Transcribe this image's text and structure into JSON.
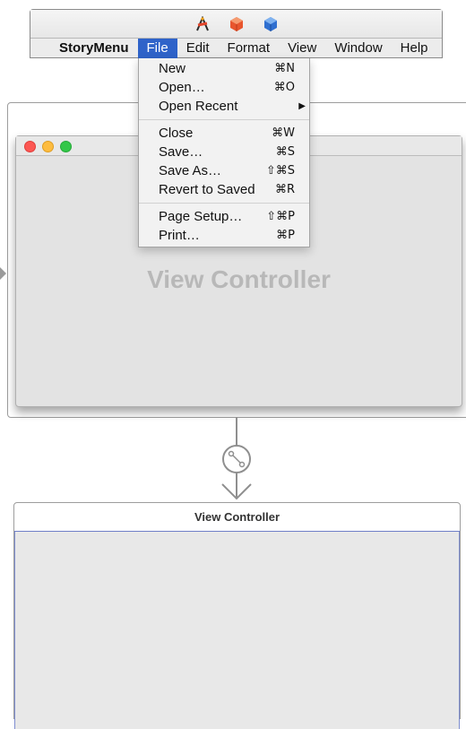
{
  "menubar": {
    "app_name": "StoryMenu",
    "items": [
      "File",
      "Edit",
      "Format",
      "View",
      "Window",
      "Help"
    ],
    "selected": "File",
    "selected_color": "#2f63c9"
  },
  "scene_dock_icons": [
    "app-icon",
    "first-responder-icon",
    "object-cube-icon"
  ],
  "file_menu": {
    "groups": [
      [
        {
          "label": "New",
          "shortcut": "⌘N"
        },
        {
          "label": "Open…",
          "shortcut": "⌘O"
        },
        {
          "label": "Open Recent",
          "submenu": true
        }
      ],
      [
        {
          "label": "Close",
          "shortcut": "⌘W"
        },
        {
          "label": "Save…",
          "shortcut": "⌘S"
        },
        {
          "label": "Save As…",
          "shortcut": "⇧⌘S"
        },
        {
          "label": "Revert to Saved",
          "shortcut": "⌘R"
        }
      ],
      [
        {
          "label": "Page Setup…",
          "shortcut": "⇧⌘P"
        },
        {
          "label": "Print…",
          "shortcut": "⌘P"
        }
      ]
    ]
  },
  "window_scene": {
    "content_label": "View Controller"
  },
  "vc_scene": {
    "title": "View Controller"
  }
}
